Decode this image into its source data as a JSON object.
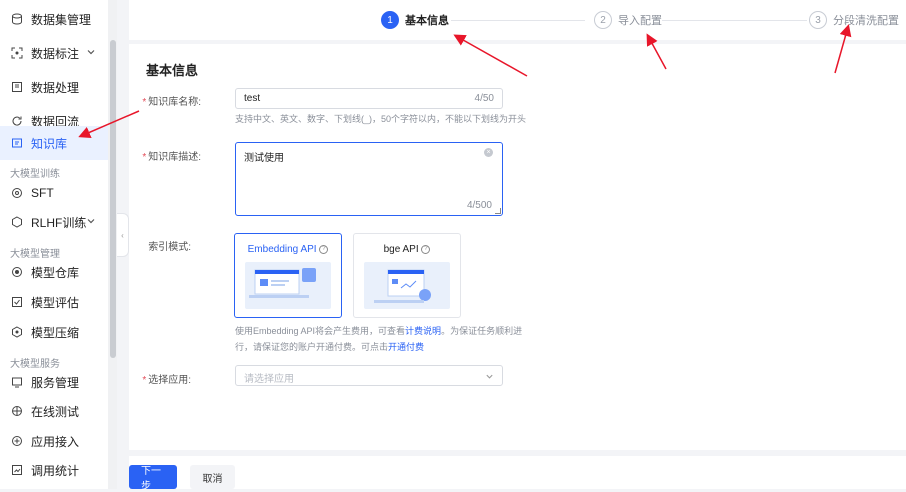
{
  "sidebar": {
    "items": [
      {
        "label": "数据集管理",
        "icon": "database-icon"
      },
      {
        "label": "数据标注",
        "icon": "annotate-icon"
      },
      {
        "label": "数据处理",
        "icon": "process-icon"
      },
      {
        "label": "数据回流",
        "icon": "reflow-icon"
      },
      {
        "label": "知识库",
        "icon": "knowledge-icon"
      },
      {
        "label": "SFT",
        "icon": "sft-icon"
      },
      {
        "label": "RLHF训练",
        "icon": "rlhf-icon"
      },
      {
        "label": "模型仓库",
        "icon": "model-repo-icon"
      },
      {
        "label": "模型评估",
        "icon": "evaluate-icon"
      },
      {
        "label": "模型压缩",
        "icon": "compress-icon"
      },
      {
        "label": "服务管理",
        "icon": "service-icon"
      },
      {
        "label": "在线测试",
        "icon": "test-icon"
      },
      {
        "label": "应用接入",
        "icon": "access-icon"
      },
      {
        "label": "调用统计",
        "icon": "stats-icon"
      }
    ],
    "groups": [
      "大模型训练",
      "大模型管理",
      "大模型服务"
    ],
    "active": "知识库"
  },
  "steps": [
    {
      "num": "1",
      "label": "基本信息"
    },
    {
      "num": "2",
      "label": "导入配置"
    },
    {
      "num": "3",
      "label": "分段清洗配置"
    }
  ],
  "form": {
    "section_title": "基本信息",
    "name_label": "知识库名称:",
    "name_value": "test",
    "name_count": "4/50",
    "name_hint": "支持中文、英文、数字、下划线(_)，50个字符以内，不能以下划线为开头",
    "desc_label": "知识库描述:",
    "desc_value": "测试使用",
    "desc_count": "4/500",
    "index_label": "索引模式:",
    "index_options": [
      {
        "label": "Embedding API",
        "selected": true
      },
      {
        "label": "bge API",
        "selected": false
      }
    ],
    "index_hint_1": "使用Embedding API将会产生费用，可查看",
    "index_hint_link1": "计费说明",
    "index_hint_2": "。为保证任务顺利进",
    "index_hint_3": "行，请保证您的账户开通付费。可点击",
    "index_hint_link2": "开通付费",
    "app_label": "选择应用:",
    "app_placeholder": "请选择应用"
  },
  "footer": {
    "next_label": "下一步",
    "cancel_label": "取消"
  },
  "colors": {
    "accent": "#2a62f4",
    "required": "#e34d59",
    "annotation": "#e8162a"
  }
}
